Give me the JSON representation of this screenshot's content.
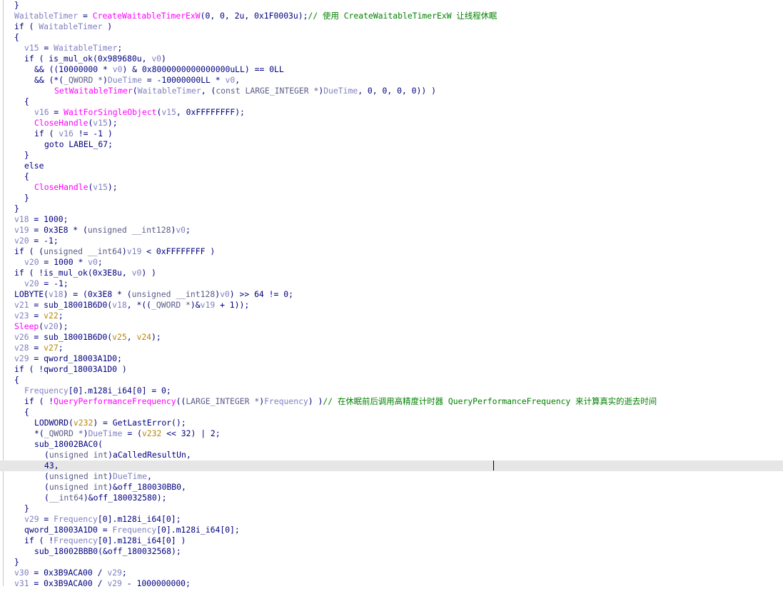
{
  "colors": {
    "default": "#000080",
    "var": "#8080c0",
    "func": "#ff00ff",
    "comment": "#008000",
    "gold": "#b8860b",
    "current_line_bg": "#e6e6e6"
  },
  "lines": [
    {
      "indent": 0,
      "tokens": [
        [
          "default",
          "}"
        ]
      ]
    },
    {
      "indent": 0,
      "tokens": [
        [
          "var",
          "WaitableTimer"
        ],
        [
          "default",
          " = "
        ],
        [
          "func",
          "CreateWaitableTimerExW"
        ],
        [
          "default",
          "(0, 0, 2u, 0x1F0003u);"
        ],
        [
          "comment",
          "// 使用 CreateWaitableTimerExW 让线程休眠"
        ]
      ]
    },
    {
      "indent": 0,
      "tokens": [
        [
          "default",
          "if ( "
        ],
        [
          "var",
          "WaitableTimer"
        ],
        [
          "default",
          " )"
        ]
      ]
    },
    {
      "indent": 0,
      "tokens": [
        [
          "default",
          "{"
        ]
      ]
    },
    {
      "indent": 1,
      "tokens": [
        [
          "var",
          "v15"
        ],
        [
          "default",
          " = "
        ],
        [
          "var",
          "WaitableTimer"
        ],
        [
          "default",
          ";"
        ]
      ]
    },
    {
      "indent": 1,
      "tokens": [
        [
          "default",
          "if ( is_mul_ok(0x989680u, "
        ],
        [
          "var",
          "v0"
        ],
        [
          "default",
          ")"
        ]
      ]
    },
    {
      "indent": 2,
      "tokens": [
        [
          "default",
          "&& ((10000000 * "
        ],
        [
          "var",
          "v0"
        ],
        [
          "default",
          ") & 0x8000000000000000uLL) == 0LL"
        ]
      ]
    },
    {
      "indent": 2,
      "tokens": [
        [
          "default",
          "&& (*("
        ],
        [
          "cast",
          "_QWORD *"
        ],
        [
          "default",
          ")"
        ],
        [
          "var",
          "DueTime"
        ],
        [
          "default",
          " = -10000000LL * "
        ],
        [
          "var",
          "v0"
        ],
        [
          "default",
          ","
        ]
      ]
    },
    {
      "indent": 4,
      "tokens": [
        [
          "func",
          "SetWaitableTimer"
        ],
        [
          "default",
          "("
        ],
        [
          "var",
          "WaitableTimer"
        ],
        [
          "default",
          ", ("
        ],
        [
          "cast",
          "const LARGE_INTEGER *"
        ],
        [
          "default",
          ")"
        ],
        [
          "var",
          "DueTime"
        ],
        [
          "default",
          ", 0, 0, 0, 0)) )"
        ]
      ]
    },
    {
      "indent": 1,
      "tokens": [
        [
          "default",
          "{"
        ]
      ]
    },
    {
      "indent": 2,
      "tokens": [
        [
          "var",
          "v16"
        ],
        [
          "default",
          " = "
        ],
        [
          "func",
          "WaitForSingleObject"
        ],
        [
          "default",
          "("
        ],
        [
          "var",
          "v15"
        ],
        [
          "default",
          ", 0xFFFFFFFF);"
        ]
      ]
    },
    {
      "indent": 2,
      "tokens": [
        [
          "func",
          "CloseHandle"
        ],
        [
          "default",
          "("
        ],
        [
          "var",
          "v15"
        ],
        [
          "default",
          ");"
        ]
      ]
    },
    {
      "indent": 2,
      "tokens": [
        [
          "default",
          "if ( "
        ],
        [
          "var",
          "v16"
        ],
        [
          "default",
          " != -1 )"
        ]
      ]
    },
    {
      "indent": 3,
      "tokens": [
        [
          "default",
          "goto LABEL_67;"
        ]
      ]
    },
    {
      "indent": 1,
      "tokens": [
        [
          "default",
          "}"
        ]
      ]
    },
    {
      "indent": 1,
      "tokens": [
        [
          "default",
          "else"
        ]
      ]
    },
    {
      "indent": 1,
      "tokens": [
        [
          "default",
          "{"
        ]
      ]
    },
    {
      "indent": 2,
      "tokens": [
        [
          "func",
          "CloseHandle"
        ],
        [
          "default",
          "("
        ],
        [
          "var",
          "v15"
        ],
        [
          "default",
          ");"
        ]
      ]
    },
    {
      "indent": 1,
      "tokens": [
        [
          "default",
          "}"
        ]
      ]
    },
    {
      "indent": 0,
      "tokens": [
        [
          "default",
          "}"
        ]
      ]
    },
    {
      "indent": 0,
      "tokens": [
        [
          "var",
          "v18"
        ],
        [
          "default",
          " = 1000;"
        ]
      ]
    },
    {
      "indent": 0,
      "tokens": [
        [
          "var",
          "v19"
        ],
        [
          "default",
          " = 0x3E8 * ("
        ],
        [
          "cast",
          "unsigned __int128"
        ],
        [
          "default",
          ")"
        ],
        [
          "var",
          "v0"
        ],
        [
          "default",
          ";"
        ]
      ]
    },
    {
      "indent": 0,
      "tokens": [
        [
          "var",
          "v20"
        ],
        [
          "default",
          " = -1;"
        ]
      ]
    },
    {
      "indent": 0,
      "tokens": [
        [
          "default",
          "if ( ("
        ],
        [
          "cast",
          "unsigned __int64"
        ],
        [
          "default",
          ")"
        ],
        [
          "var",
          "v19"
        ],
        [
          "default",
          " < 0xFFFFFFFF )"
        ]
      ]
    },
    {
      "indent": 1,
      "tokens": [
        [
          "var",
          "v20"
        ],
        [
          "default",
          " = 1000 * "
        ],
        [
          "var",
          "v0"
        ],
        [
          "default",
          ";"
        ]
      ]
    },
    {
      "indent": 0,
      "tokens": [
        [
          "default",
          "if ( !is_mul_ok(0x3E8u, "
        ],
        [
          "var",
          "v0"
        ],
        [
          "default",
          ") )"
        ]
      ]
    },
    {
      "indent": 1,
      "tokens": [
        [
          "var",
          "v20"
        ],
        [
          "default",
          " = -1;"
        ]
      ]
    },
    {
      "indent": 0,
      "tokens": [
        [
          "default",
          "LOBYTE("
        ],
        [
          "var",
          "v18"
        ],
        [
          "default",
          ") = (0x3E8 * ("
        ],
        [
          "cast",
          "unsigned __int128"
        ],
        [
          "default",
          ")"
        ],
        [
          "var",
          "v0"
        ],
        [
          "default",
          ") >> 64 != 0;"
        ]
      ]
    },
    {
      "indent": 0,
      "tokens": [
        [
          "var",
          "v21"
        ],
        [
          "default",
          " = sub_18001B6D0("
        ],
        [
          "var",
          "v18"
        ],
        [
          "default",
          ", *(("
        ],
        [
          "cast",
          "_QWORD *"
        ],
        [
          "default",
          ")&"
        ],
        [
          "var",
          "v19"
        ],
        [
          "default",
          " + 1));"
        ]
      ]
    },
    {
      "indent": 0,
      "tokens": [
        [
          "var",
          "v23"
        ],
        [
          "default",
          " = "
        ],
        [
          "gold",
          "v22"
        ],
        [
          "default",
          ";"
        ]
      ]
    },
    {
      "indent": 0,
      "tokens": [
        [
          "func",
          "Sleep"
        ],
        [
          "default",
          "("
        ],
        [
          "var",
          "v20"
        ],
        [
          "default",
          ");"
        ]
      ]
    },
    {
      "indent": 0,
      "tokens": [
        [
          "var",
          "v26"
        ],
        [
          "default",
          " = sub_18001B6D0("
        ],
        [
          "gold",
          "v25"
        ],
        [
          "default",
          ", "
        ],
        [
          "gold",
          "v24"
        ],
        [
          "default",
          ");"
        ]
      ]
    },
    {
      "indent": 0,
      "tokens": [
        [
          "var",
          "v28"
        ],
        [
          "default",
          " = "
        ],
        [
          "gold",
          "v27"
        ],
        [
          "default",
          ";"
        ]
      ]
    },
    {
      "indent": 0,
      "tokens": [
        [
          "var",
          "v29"
        ],
        [
          "default",
          " = qword_18003A1D0;"
        ]
      ]
    },
    {
      "indent": 0,
      "tokens": [
        [
          "default",
          "if ( !qword_18003A1D0 )"
        ]
      ]
    },
    {
      "indent": 0,
      "tokens": [
        [
          "default",
          "{"
        ]
      ]
    },
    {
      "indent": 1,
      "tokens": [
        [
          "var",
          "Frequency"
        ],
        [
          "default",
          "[0].m128i_i64[0] = 0;"
        ]
      ]
    },
    {
      "indent": 1,
      "tokens": [
        [
          "default",
          "if ( !"
        ],
        [
          "func",
          "QueryPerformanceFrequency"
        ],
        [
          "default",
          "(("
        ],
        [
          "cast",
          "LARGE_INTEGER *"
        ],
        [
          "default",
          ")"
        ],
        [
          "var",
          "Frequency"
        ],
        [
          "default",
          ") )"
        ],
        [
          "comment",
          "// 在休眠前后调用高精度计时器 QueryPerformanceFrequency 来计算真实的逝去时间"
        ]
      ]
    },
    {
      "indent": 1,
      "tokens": [
        [
          "default",
          "{"
        ]
      ]
    },
    {
      "indent": 2,
      "tokens": [
        [
          "default",
          "LODWORD("
        ],
        [
          "gold",
          "v232"
        ],
        [
          "default",
          ") = GetLastError();"
        ]
      ]
    },
    {
      "indent": 2,
      "tokens": [
        [
          "default",
          "*("
        ],
        [
          "cast",
          "_QWORD *"
        ],
        [
          "default",
          ")"
        ],
        [
          "var",
          "DueTime"
        ],
        [
          "default",
          " = ("
        ],
        [
          "gold",
          "v232"
        ],
        [
          "default",
          " << 32) | 2;"
        ]
      ]
    },
    {
      "indent": 2,
      "tokens": [
        [
          "default",
          "sub_18002BAC0("
        ]
      ]
    },
    {
      "indent": 3,
      "tokens": [
        [
          "default",
          "("
        ],
        [
          "cast",
          "unsigned int"
        ],
        [
          "default",
          ")aCalledResultUn,"
        ]
      ]
    },
    {
      "indent": 3,
      "current": true,
      "tokens": [
        [
          "default",
          "43,"
        ]
      ]
    },
    {
      "indent": 3,
      "tokens": [
        [
          "default",
          "("
        ],
        [
          "cast",
          "unsigned int"
        ],
        [
          "default",
          ")"
        ],
        [
          "var",
          "DueTime"
        ],
        [
          "default",
          ","
        ]
      ]
    },
    {
      "indent": 3,
      "tokens": [
        [
          "default",
          "("
        ],
        [
          "cast",
          "unsigned int"
        ],
        [
          "default",
          ")&off_180030BB0,"
        ]
      ]
    },
    {
      "indent": 3,
      "tokens": [
        [
          "default",
          "("
        ],
        [
          "cast",
          "__int64"
        ],
        [
          "default",
          ")&off_180032580);"
        ]
      ]
    },
    {
      "indent": 1,
      "tokens": [
        [
          "default",
          "}"
        ]
      ]
    },
    {
      "indent": 1,
      "tokens": [
        [
          "var",
          "v29"
        ],
        [
          "default",
          " = "
        ],
        [
          "var",
          "Frequency"
        ],
        [
          "default",
          "[0].m128i_i64[0];"
        ]
      ]
    },
    {
      "indent": 1,
      "tokens": [
        [
          "default",
          "qword_18003A1D0 = "
        ],
        [
          "var",
          "Frequency"
        ],
        [
          "default",
          "[0].m128i_i64[0];"
        ]
      ]
    },
    {
      "indent": 1,
      "tokens": [
        [
          "default",
          "if ( !"
        ],
        [
          "var",
          "Frequency"
        ],
        [
          "default",
          "[0].m128i_i64[0] )"
        ]
      ]
    },
    {
      "indent": 2,
      "tokens": [
        [
          "default",
          "sub_18002BBB0(&off_180032568);"
        ]
      ]
    },
    {
      "indent": 0,
      "tokens": [
        [
          "default",
          "}"
        ]
      ]
    },
    {
      "indent": 0,
      "tokens": [
        [
          "var",
          "v30"
        ],
        [
          "default",
          " = 0x3B9ACA00 / "
        ],
        [
          "var",
          "v29"
        ],
        [
          "default",
          ";"
        ]
      ]
    },
    {
      "indent": 0,
      "tokens": [
        [
          "var",
          "v31"
        ],
        [
          "default",
          " = 0x3B9ACA00 / "
        ],
        [
          "var",
          "v29"
        ],
        [
          "default",
          " - 1000000000;"
        ]
      ]
    }
  ]
}
